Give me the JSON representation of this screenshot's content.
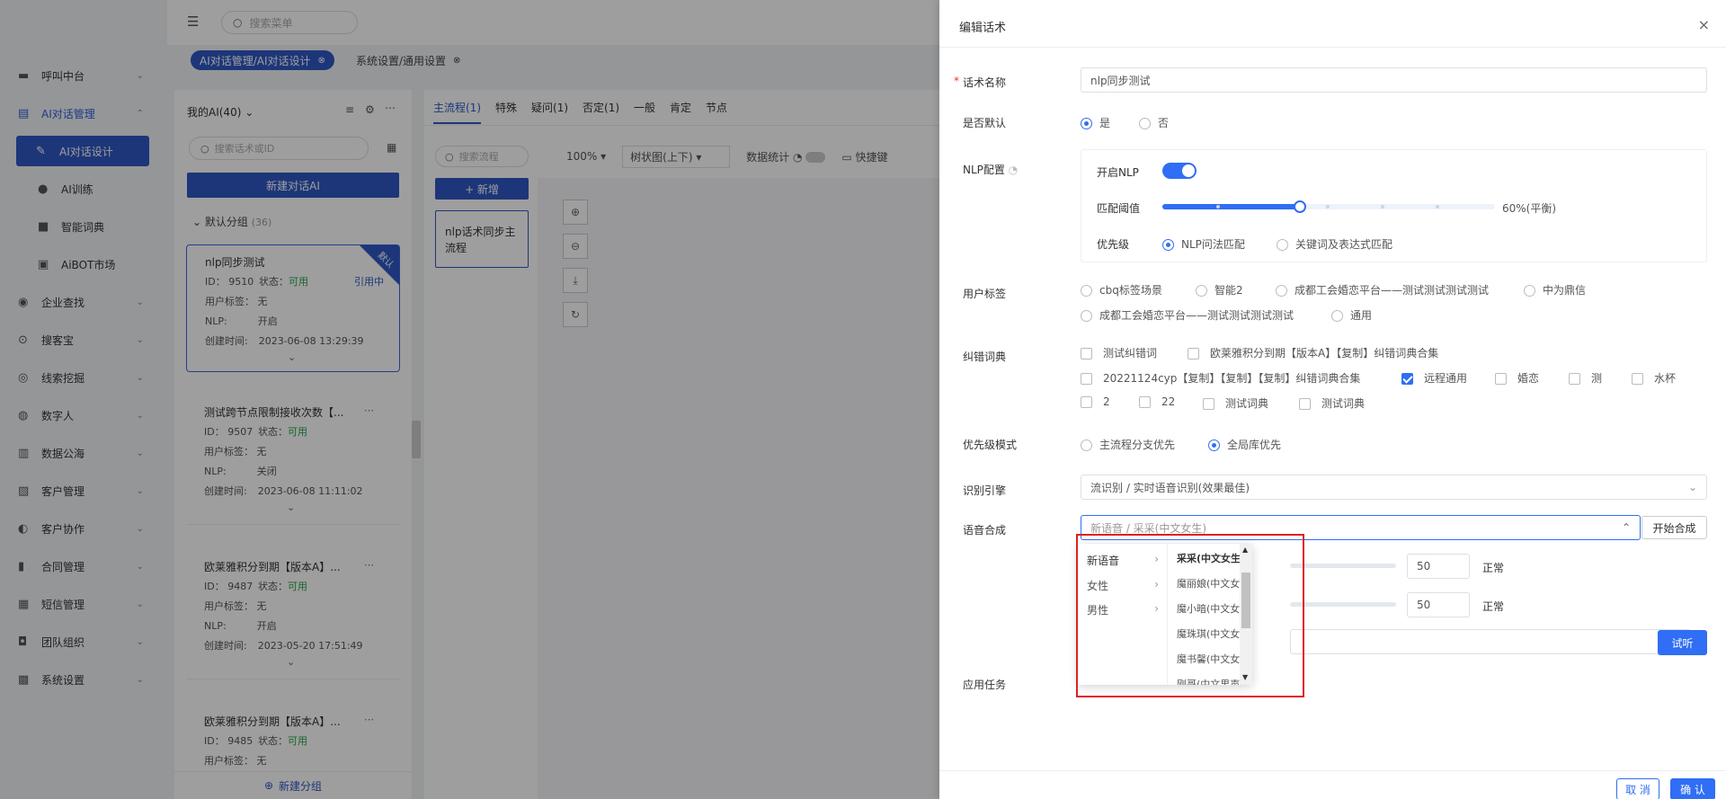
{
  "topbar": {
    "search_placeholder": "搜索菜单"
  },
  "tabs": [
    {
      "label": "AI对话管理/AI对话设计"
    },
    {
      "label": "系统设置/通用设置"
    }
  ],
  "sidebar": {
    "items": [
      {
        "label": "呼叫中台",
        "icon": "monitor-icon"
      },
      {
        "label": "AI对话管理",
        "icon": "chat-icon"
      },
      {
        "label": "AI对话设计",
        "icon": "pen-icon"
      },
      {
        "label": "AI训练",
        "icon": "bubble-icon"
      },
      {
        "label": "智能词典",
        "icon": "book-icon"
      },
      {
        "label": "AiBOT市场",
        "icon": "store-icon"
      },
      {
        "label": "企业查找",
        "icon": "bulb-icon"
      },
      {
        "label": "搜客宝",
        "icon": "magnify-icon"
      },
      {
        "label": "线索挖掘",
        "icon": "target-icon"
      },
      {
        "label": "数字人",
        "icon": "person-icon"
      },
      {
        "label": "数据公海",
        "icon": "chart-icon"
      },
      {
        "label": "客户管理",
        "icon": "contacts-icon"
      },
      {
        "label": "客户协作",
        "icon": "globe-icon"
      },
      {
        "label": "合同管理",
        "icon": "clipboard-icon"
      },
      {
        "label": "短信管理",
        "icon": "sms-icon"
      },
      {
        "label": "团队组织",
        "icon": "team-icon"
      },
      {
        "label": "系统设置",
        "icon": "grid-icon"
      }
    ]
  },
  "ai_list": {
    "title": "我的AI(40)",
    "search_placeholder": "搜索话术或ID",
    "new_button": "新建对话AI",
    "group": "默认分组",
    "group_count": "(36)",
    "new_group": "新建分组",
    "cards": [
      {
        "name": "nlp同步测试",
        "id": "ID： 9510",
        "status_label": "状态：",
        "status": "可用",
        "tag": "用户标签： 无",
        "nlp": "NLP:",
        "nlp_value": "开启",
        "created_label": "创建时间:",
        "created": "2023-06-08 13:29:39",
        "ref": "引用中",
        "badge": "默认"
      },
      {
        "name": "测试跨节点限制接收次数【...",
        "id": "ID： 9507",
        "status_label": "状态：",
        "status": "可用",
        "tag": "用户标签： 无",
        "nlp": "NLP:",
        "nlp_value": "关闭",
        "created_label": "创建时间:",
        "created": "2023-06-08 11:11:02"
      },
      {
        "name": "欧莱雅积分到期【版本A】...",
        "id": "ID： 9487",
        "status_label": "状态：",
        "status": "可用",
        "tag": "用户标签： 无",
        "nlp": "NLP:",
        "nlp_value": "开启",
        "created_label": "创建时间:",
        "created": "2023-05-20 17:51:49"
      },
      {
        "name": "欧莱雅积分到期【版本A】...",
        "id": "ID： 9485",
        "status_label": "状态：",
        "status": "可用",
        "tag": "用户标签： 无"
      }
    ]
  },
  "flow": {
    "tabs": [
      "主流程(1)",
      "特殊",
      "疑问(1)",
      "否定(1)",
      "一般",
      "肯定",
      "节点"
    ],
    "search_placeholder": "搜索流程",
    "add_button": "+ 新增",
    "node": "nlp话术同步主流程",
    "zoom": "100%",
    "layout": "树状图(上下)",
    "stats": "数据统计",
    "shortcut": "快捷键"
  },
  "panel": {
    "title": "编辑话术",
    "name_label": "话术名称",
    "name_value": "nlp同步测试",
    "default_label": "是否默认",
    "default_yes": "是",
    "default_no": "否",
    "nlp_label": "NLP配置",
    "nlp_enable": "开启NLP",
    "threshold_label": "匹配阈值",
    "threshold_value": "60%(平衡)",
    "threshold_level": 0.6,
    "priority_label": "优先级",
    "priority_opt1": "NLP问法匹配",
    "priority_opt2": "关键词及表达式匹配",
    "user_tag_label": "用户标签",
    "user_tags": [
      "cbq标签场景",
      "智能2",
      "成都工会婚恋平台——测试测试测试测试",
      "中为鼎信",
      "成都工会婚恋平台——测试测试测试测试",
      "通用"
    ],
    "dict_label": "纠错词典",
    "dicts": [
      {
        "label": "测试纠错词",
        "checked": false
      },
      {
        "label": "欧莱雅积分到期【版本A】【复制】纠错词典合集",
        "checked": false
      },
      {
        "label": "20221124cyp【复制】【复制】【复制】纠错词典合集",
        "checked": false
      },
      {
        "label": "远程通用",
        "checked": true
      },
      {
        "label": "婚恋",
        "checked": false
      },
      {
        "label": "测",
        "checked": false
      },
      {
        "label": "水杯",
        "checked": false
      },
      {
        "label": "2",
        "checked": false
      },
      {
        "label": "22",
        "checked": false
      },
      {
        "label": "测试词典",
        "checked": false
      },
      {
        "label": "测试词典",
        "checked": false
      }
    ],
    "mode_label": "优先级模式",
    "mode_opt1": "主流程分支优先",
    "mode_opt2": "全局库优先",
    "engine_label": "识别引擎",
    "engine_value": "流识别 / 实时语音识别(效果最佳)",
    "tts_label": "语音合成",
    "tts_value": "新语音 / 采采(中文女生)",
    "tts_button": "开始合成",
    "speed_value": "50",
    "speed_text": "正常",
    "volume_value": "50",
    "volume_text": "正常",
    "listen_button": "试听",
    "task_label": "应用任务",
    "cancel": "取 消",
    "confirm": "确 认"
  },
  "dropdown": {
    "categories": [
      "新语音",
      "女性",
      "男性"
    ],
    "voices": [
      "采采(中文女生)",
      "魔丽娘(中文女生)",
      "魔小暗(中文女生)",
      "魔珠琪(中文女生)",
      "魔书馨(中文女生)",
      "刚哥(中文男声)"
    ]
  }
}
